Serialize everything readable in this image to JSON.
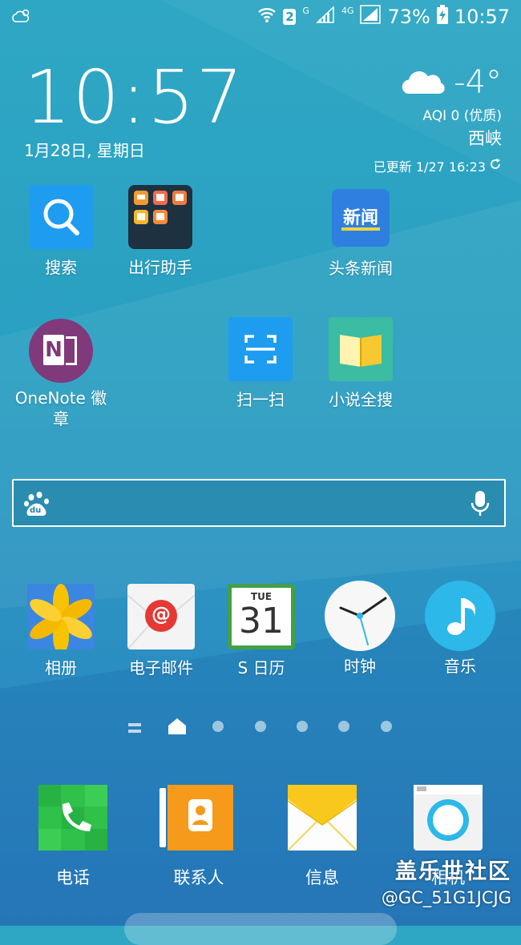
{
  "status_bar": {
    "sim_badge": "2",
    "net_g": "G",
    "net_4g": "4G",
    "battery": "73%",
    "time": "10:57"
  },
  "clock": {
    "time": "10:57",
    "date": "1月28日, 星期日"
  },
  "weather": {
    "temp": "-4°",
    "aqi": "AQI 0 (优质)",
    "city": "西峡",
    "updated": "已更新 1/27 16:23"
  },
  "apps_row1": [
    {
      "label": "搜索",
      "icon": "search-icon"
    },
    {
      "label": "出行助手",
      "icon": "travel-folder-icon"
    },
    {
      "label": "头条新闻",
      "icon": "news-icon",
      "icon_text": "新闻"
    }
  ],
  "apps_row2": [
    {
      "label": "OneNote 徽\n章",
      "icon": "onenote-icon",
      "icon_text": "N"
    },
    {
      "label": "扫一扫",
      "icon": "scan-icon"
    },
    {
      "label": "小说全搜",
      "icon": "book-icon"
    }
  ],
  "search": {
    "engine_icon": "baidu-paw-icon",
    "engine_text": "du",
    "mic_icon": "mic-icon"
  },
  "apps_row3": [
    {
      "label": "相册",
      "icon": "gallery-icon"
    },
    {
      "label": "电子邮件",
      "icon": "email-icon",
      "icon_text": "@"
    },
    {
      "label": "S 日历",
      "icon": "calendar-icon",
      "day_name": "TUE",
      "day_num": "31"
    },
    {
      "label": "时钟",
      "icon": "clock-icon"
    },
    {
      "label": "音乐",
      "icon": "music-icon"
    }
  ],
  "pager": {
    "active_index": 1,
    "total_pages": 6
  },
  "dock": [
    {
      "label": "电话",
      "icon": "phone-icon"
    },
    {
      "label": "联系人",
      "icon": "contacts-icon"
    },
    {
      "label": "信息",
      "icon": "messages-icon"
    },
    {
      "label": "相机",
      "icon": "camera-icon"
    }
  ],
  "watermark": {
    "title": "盖乐世社区",
    "user": "@GC_51G1JCJG"
  },
  "colors": {
    "search_blue": "#1e9cf0",
    "news_blue": "#2f7fe0",
    "onenote_purple": "#80397b",
    "book_teal": "#3cbca2",
    "gallery_yellow": "#f7c300",
    "email_red": "#e53935",
    "calendar_green": "#43a047",
    "music_cyan": "#2cb8e8",
    "phone_green": "#2fc14a",
    "contacts_orange": "#f59a1a",
    "messages_yellow": "#f9c81c"
  }
}
